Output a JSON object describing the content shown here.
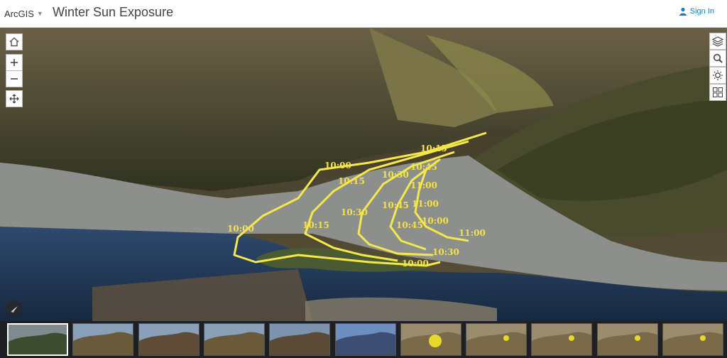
{
  "header": {
    "brand": "ArcGIS",
    "title": "Winter Sun Exposure",
    "signin_label": "Sign In"
  },
  "map": {
    "contour_color": "#f5e94a",
    "labels": [
      "10:00",
      "10:15",
      "10:30",
      "10:45",
      "11:00",
      "10:00",
      "10:15",
      "10:30",
      "10:45",
      "11:00",
      "10:00",
      "10:15",
      "10:30",
      "10:45",
      "11:00",
      "10:00"
    ]
  },
  "controls": {
    "left": [
      "home-icon",
      "zoom-in-icon",
      "zoom-out-icon",
      "pan-icon"
    ],
    "right": [
      "layers-icon",
      "search-icon",
      "daylight-icon",
      "basemap-gallery-icon"
    ]
  },
  "slides_count": 11,
  "active_slide": 0
}
